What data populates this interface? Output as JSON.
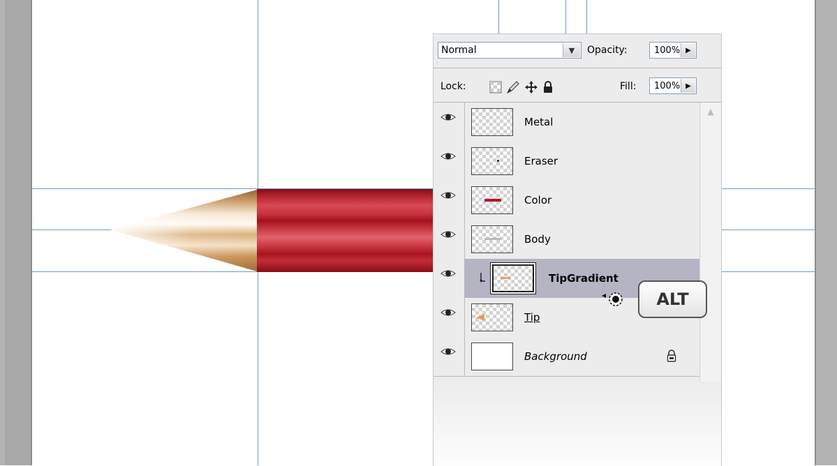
{
  "layers_panel": {
    "blend_mode": "Normal",
    "opacity_label": "Opacity:",
    "opacity_value": "100%",
    "lock_label": "Lock:",
    "fill_label": "Fill:",
    "fill_value": "100%",
    "layers": [
      {
        "name": "Metal",
        "visible": true,
        "selected": false
      },
      {
        "name": "Eraser",
        "visible": true,
        "selected": false
      },
      {
        "name": "Color",
        "visible": true,
        "selected": false
      },
      {
        "name": "Body",
        "visible": true,
        "selected": false
      },
      {
        "name": "TipGradient",
        "visible": true,
        "selected": true,
        "clipping_mask": true
      },
      {
        "name": "Tip",
        "visible": true,
        "selected": false
      },
      {
        "name": "Background",
        "visible": true,
        "selected": false,
        "locked": true
      }
    ]
  },
  "key_hint": "ALT",
  "colors": {
    "guide": "#6f96d8",
    "pencil_body": "#c8323d",
    "tip_wood": "#c8975a",
    "selected_layer": "#b4b4c3"
  }
}
